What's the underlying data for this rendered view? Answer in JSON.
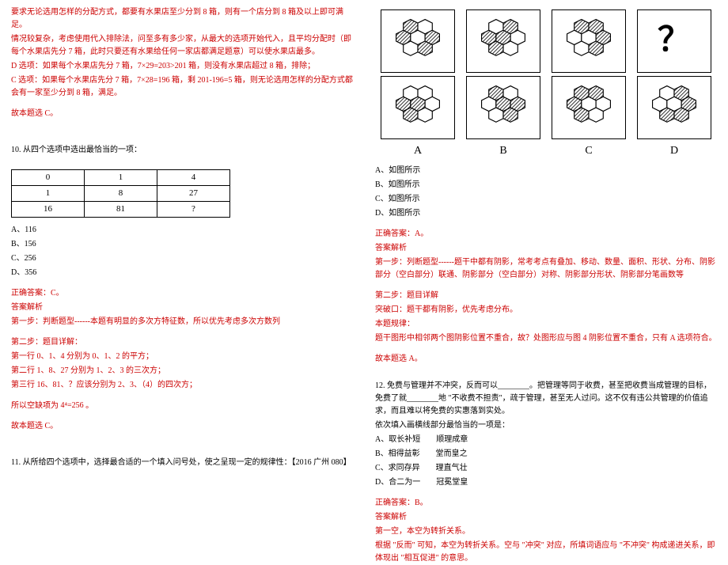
{
  "leftCol": {
    "topRed": [
      "要求无论选用怎样的分配方式，都要有水果店至少分到 8 箱，则有一个店分到 8 箱及以上即可满足。",
      "情况较复杂，考虑使用代入排除法，问至多有多少家，从最大的选项开始代入，且平均分配时（即每个水果店先分 7 箱，此时只要还有水果给任何一家店都满足题意）可以使水果店最多。",
      "D 选项：如果每个水果店先分 7 箱，7×29=203>201 箱，则没有水果店超过 8 箱，排除；",
      "C 选项：如果每个水果店先分 7 箱，7×28=196 箱，剩 201-196=5 箱，则无论选用怎样的分配方式都会有一家至少分到 8 箱，满足。",
      "",
      "故本题选 C。"
    ],
    "q10": {
      "title": "10. 从四个选项中选出最恰当的一项：",
      "table": [
        [
          "0",
          "1",
          "4"
        ],
        [
          "1",
          "8",
          "27"
        ],
        [
          "16",
          "81",
          "?"
        ]
      ],
      "opts": [
        "A、116",
        "B、156",
        "C、256",
        "D、356"
      ]
    },
    "q10ans": {
      "correct": "正确答案：C。",
      "header": "答案解析",
      "step1": "第一步：判断题型------本题有明显的多次方特征数，所以优先考虑多次方数列",
      "step2hdr": "第二步：题目详解：",
      "lines": [
        "第一行 0、1、4 分别为 0、1、2 的平方；",
        "第二行 1、8、27 分别为 1、2、3 的三次方；",
        "第三行 16、81、？应该分别为 2、3、（4）的四次方；"
      ],
      "formula_pre": "所以空缺项为",
      "formula": "4⁴=256",
      "formula_post": "。",
      "end": "故本题选 C。"
    },
    "q11": {
      "title": "11. 从所给四个选项中，选择最合适的一个填入问号处，使之呈现一定的规律性：【2016 广州 080】"
    }
  },
  "rightCol": {
    "qmark": "？",
    "labels": [
      "A",
      "B",
      "C",
      "D"
    ],
    "opts": [
      "A、如图所示",
      "B、如图所示",
      "C、如图所示",
      "D、如图所示"
    ],
    "ans11": {
      "correct": "正确答案：A。",
      "header": "答案解析",
      "step1": "第一步：列断题型------题干中都有阴影，常考考点有叠加、移动、数量、面积、形状、分布、阴影部分（空白部分）联通、阴影部分（空白部分）对称、阴影部分形状、阴影部分笔画数等",
      "step2hdr": "第二步：题目详解",
      "lines": [
        "突破口：题干都有阴影，优先考虑分布。",
        "本题规律：",
        "题干图形中相邻两个图阴影位置不重合，故？处图形应与图 4 阴影位置不重合，只有 A 选项符合。"
      ],
      "end": "故本题选 A。"
    },
    "q12": {
      "stem1": "12. 免费与管理并不冲突，反而可以________。把管理等同于收费，甚至把收费当成管理的目标，免费了就________地 \"不收费不担责\"，疏于管理，甚至无人过问。这不仅有违公共管理的价值追求，而且难以将免费的实惠落到实处。",
      "stem2": "依次填入画横线部分最恰当的一项是：",
      "opts": [
        "A、取长补短　　顺理成章",
        "B、相得益彰　　堂而皇之",
        "C、求同存异　　理直气壮",
        "D、合二为一　　冠冕堂皇"
      ]
    },
    "ans12": {
      "correct": "正确答案：B。",
      "header": "答案解析",
      "line1": "第一空，本空为转折关系。",
      "line2": "根据 \"反而\" 可知，本空为转折关系。空与 \"冲突\" 对应，所填词语应与 \"不冲突\" 构成递进关系，即体现出 \"相互促进\" 的意思。"
    }
  }
}
